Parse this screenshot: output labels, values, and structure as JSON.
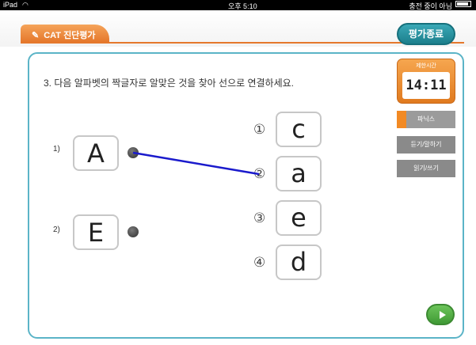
{
  "statusbar": {
    "device": "iPad",
    "wifi": "wifi-icon",
    "time": "오후 5:10",
    "battery": "충전 중이 아님"
  },
  "header": {
    "tab_label": "CAT 진단평가",
    "end_button": "평가종료"
  },
  "question": {
    "text": "3. 다음 알파벳의 짝글자로 알맞은 것을 찾아 선으로 연결하세요."
  },
  "left_items": [
    {
      "number": "1)",
      "letter": "A"
    },
    {
      "number": "2)",
      "letter": "E"
    }
  ],
  "right_items": [
    {
      "number": "①",
      "letter": "c"
    },
    {
      "number": "②",
      "letter": "a"
    },
    {
      "number": "③",
      "letter": "e"
    },
    {
      "number": "④",
      "letter": "d"
    }
  ],
  "connection": {
    "from": "A",
    "to": "a",
    "color": "#1a1acc"
  },
  "timer": {
    "title": "제한시간",
    "value": "14:11"
  },
  "sidebar": [
    {
      "label": "파닉스",
      "active": true
    },
    {
      "label": "듣기/말하기",
      "active": false
    },
    {
      "label": "읽기/쓰기",
      "active": false
    }
  ],
  "colors": {
    "accent_orange": "#e5782c",
    "panel_border": "#5bb4c7",
    "end_button": "#1c7f8c",
    "play_button": "#3f9a35"
  }
}
